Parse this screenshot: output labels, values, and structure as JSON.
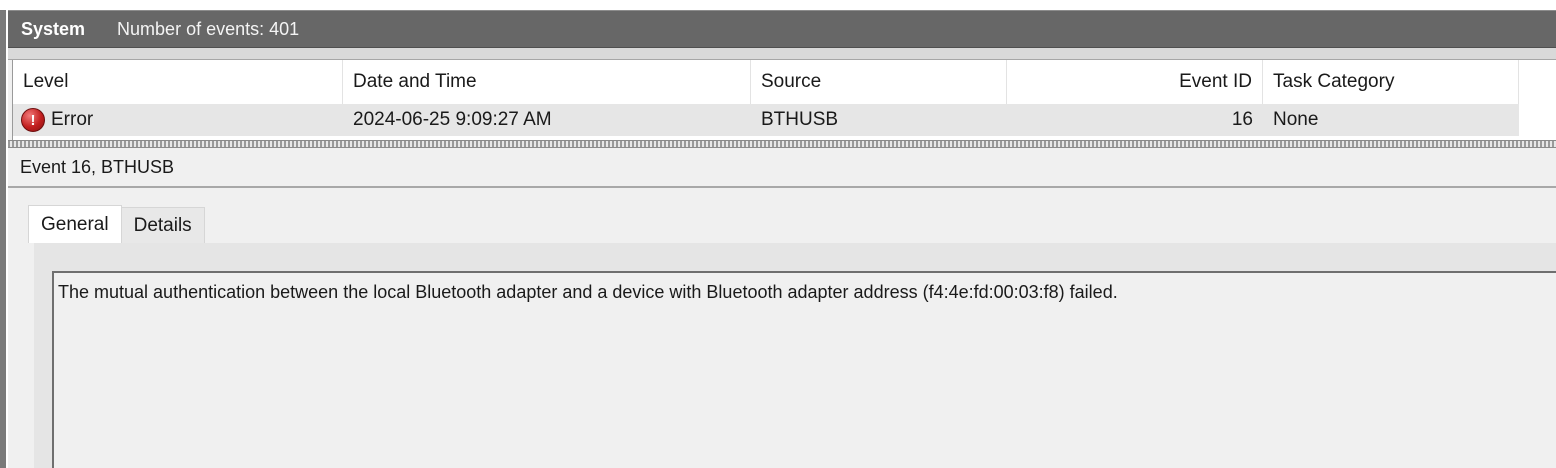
{
  "header": {
    "log_name": "System",
    "event_count_text": "Number of events: 401"
  },
  "list": {
    "columns": [
      "Level",
      "Date and Time",
      "Source",
      "Event ID",
      "Task Category"
    ],
    "rows": [
      {
        "level_icon": "error-icon",
        "level": "Error",
        "datetime": "2024-06-25 9:09:27 AM",
        "source": "BTHUSB",
        "event_id": "16",
        "task_category": "None"
      }
    ]
  },
  "details": {
    "title": "Event 16, BTHUSB",
    "tabs": [
      "General",
      "Details"
    ],
    "active_tab": "General",
    "message": "The mutual authentication between the local Bluetooth adapter and a device with Bluetooth adapter address (f4:4e:fd:00:03:f8) failed."
  },
  "colors": {
    "header_bg": "#676767",
    "selected_row_bg": "#e6e6e6",
    "error_icon": "#c21f1f"
  }
}
